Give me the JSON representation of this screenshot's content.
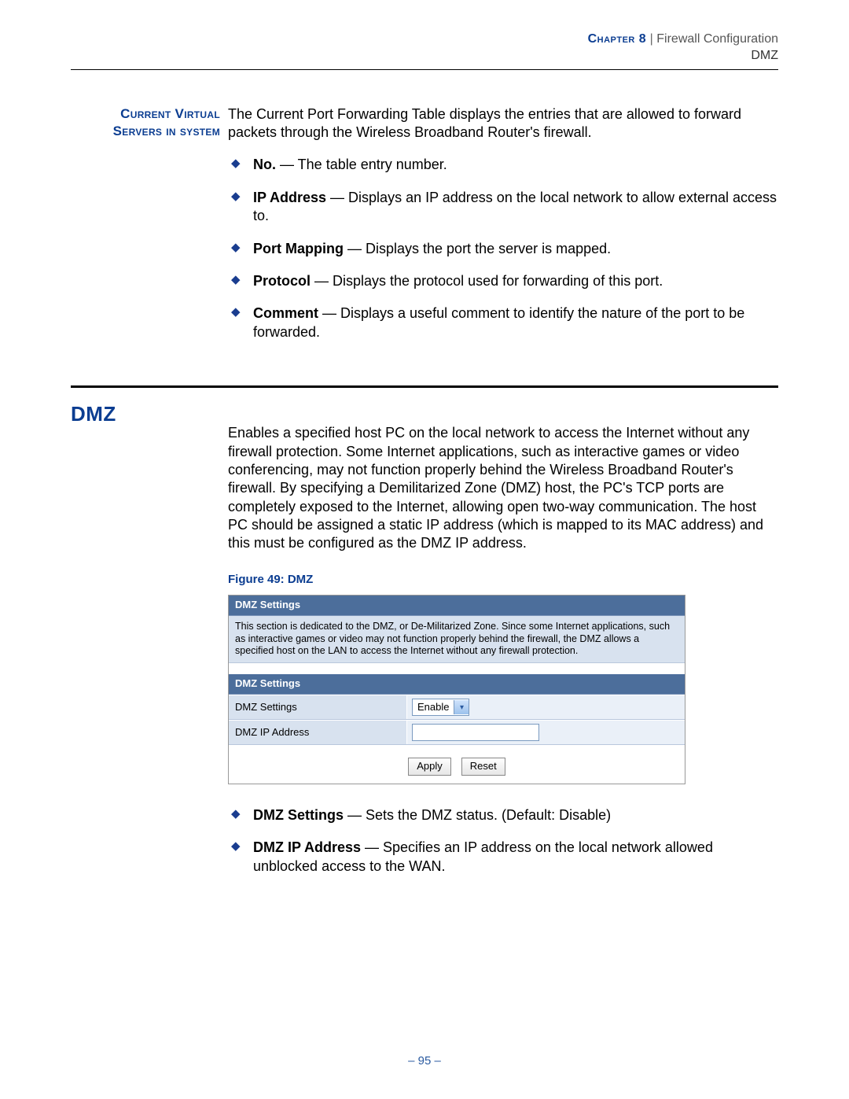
{
  "header": {
    "chapter_label": "Chapter 8",
    "separator": " | ",
    "chapter_name": "Firewall Configuration",
    "sub": "DMZ"
  },
  "section1": {
    "side_label_line1": "Current Virtual",
    "side_label_line2": "Servers in system",
    "intro": "The Current Port Forwarding Table displays the entries that are allowed to forward packets through the Wireless Broadband Router's firewall.",
    "bullets": {
      "b1_term": "No.",
      "b1_rest": " — The table entry number.",
      "b2_term": "IP Address",
      "b2_rest": " — Displays an IP address on the local network to allow external access to.",
      "b3_term": "Port Mapping",
      "b3_rest": " — Displays the port the server is mapped.",
      "b4_term": "Protocol",
      "b4_rest": " — Displays the protocol used for forwarding of this port.",
      "b5_term": "Comment",
      "b5_rest": " — Displays a useful comment to identify the nature of the port to be forwarded."
    }
  },
  "dmz": {
    "heading": "DMZ",
    "para": "Enables a specified host PC on the local network to access the Internet without any firewall protection. Some Internet applications, such as interactive games or video conferencing, may not function properly behind the Wireless Broadband Router's firewall. By specifying a Demilitarized Zone (DMZ) host, the PC's TCP ports are completely exposed to the Internet, allowing open two-way communication. The host PC should be assigned a static IP address (which is mapped to its MAC address) and this must be configured as the DMZ IP address.",
    "figure_caption": "Figure 49:  DMZ",
    "panel": {
      "header1": "DMZ Settings",
      "desc": "This section is dedicated to the DMZ, or De-Militarized Zone. Since some Internet applications, such as interactive games or video may not function properly behind the firewall, the DMZ allows a specified host on the LAN to access the Internet without any firewall protection.",
      "header2": "DMZ Settings",
      "row1_label": "DMZ Settings",
      "row1_value": "Enable",
      "row2_label": "DMZ IP Address",
      "row2_value": "",
      "apply": "Apply",
      "reset": "Reset"
    },
    "bullets": {
      "b1_term": "DMZ Settings",
      "b1_rest": " — Sets the DMZ status. (Default: Disable)",
      "b2_term": "DMZ IP Address",
      "b2_rest": " — Specifies an IP address on the local network allowed unblocked access to the WAN."
    }
  },
  "footer": {
    "page": "–  95  –"
  }
}
